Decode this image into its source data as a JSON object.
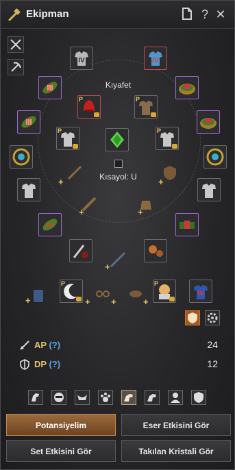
{
  "window": {
    "title": "Ekipman"
  },
  "titlebar": {
    "doc_icon": "document-icon",
    "help": "?",
    "close": "✕"
  },
  "center": {
    "outfit_label": "Kıyafet",
    "shortcut_label": "Kısayol: U"
  },
  "slot_marks": {
    "p": "P",
    "iv": "IV"
  },
  "stats": {
    "ap_label": "AP",
    "ap_help": "(?)",
    "ap_value": "24",
    "dp_label": "DP",
    "dp_help": "(?)",
    "dp_value": "12"
  },
  "buttons": {
    "potential": "Potansiyelim",
    "artifact": "Eser Etkisini Gör",
    "set": "Set Etkisini Gör",
    "crystal": "Takılan Kristali Gör"
  },
  "colors": {
    "accent_gold": "#e7c66a",
    "purple_border": "#9f6ad8",
    "button_primary": "#8a5a30"
  },
  "icons": [
    "hammer-icon",
    "document-icon",
    "help-icon",
    "close-icon",
    "swords-icon",
    "pickaxe-icon",
    "shield-icon",
    "gear-icon"
  ]
}
